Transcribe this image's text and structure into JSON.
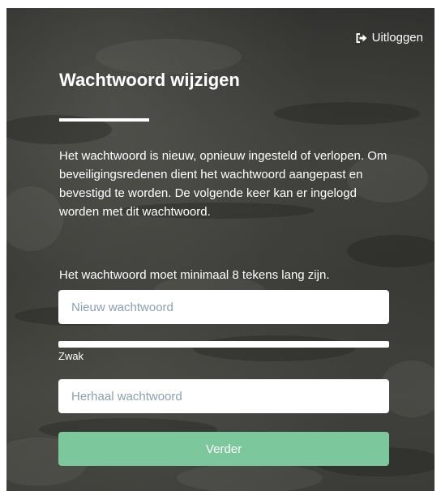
{
  "header": {
    "logout_label": "Uitloggen",
    "logout_icon": "sign-out-icon"
  },
  "form": {
    "title": "Wachtwoord wijzigen",
    "intro": "Het wachtwoord is nieuw, opnieuw ingesteld of verlopen. Om beveiligingsredenen dient het wachtwoord aangepast en bevestigd te worden. De volgende keer kan er ingelogd worden met dit wachtwoord.",
    "min_length_notice": "Het wachtwoord moet minimaal 8 tekens lang zijn.",
    "new_password": {
      "placeholder": "Nieuw wachtwoord",
      "value": ""
    },
    "strength": {
      "label": "Zwak"
    },
    "repeat_password": {
      "placeholder": "Herhaal wachtwoord",
      "value": ""
    },
    "submit_label": "Verder"
  },
  "colors": {
    "submit_button": "#7cc79b",
    "text": "#ffffff",
    "placeholder": "#8aa0b4"
  }
}
